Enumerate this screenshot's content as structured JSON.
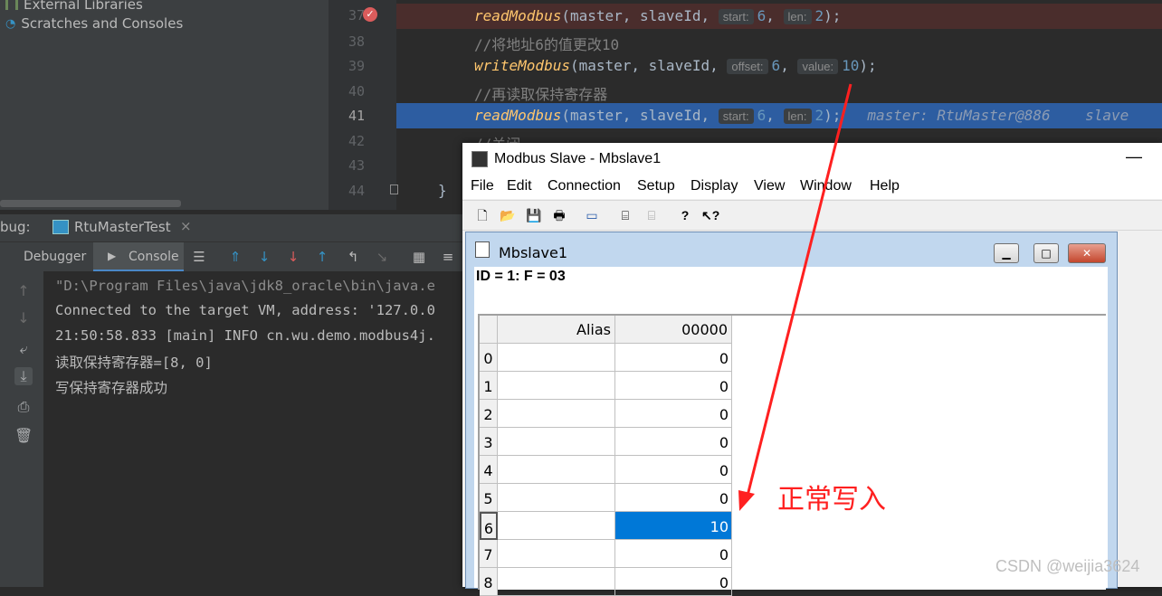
{
  "project": {
    "items": [
      "External Libraries",
      "Scratches and Consoles"
    ]
  },
  "editor": {
    "line_numbers": [
      "37",
      "38",
      "39",
      "40",
      "41",
      "42",
      "43",
      "44"
    ],
    "line37": {
      "fn": "readModbus",
      "args": "(master, slaveId, ",
      "hint1": "start:",
      "v1": "6",
      "hint2": "len:",
      "v2": "2",
      "end": ");"
    },
    "line38": "//将地址6的值更改10",
    "line39": {
      "fn": "writeModbus",
      "args": "(master, slaveId, ",
      "hint1": "offset:",
      "v1": "6",
      "hint2": "value:",
      "v2": "10",
      "end": ");"
    },
    "line40": "//再读取保持寄存器",
    "line41": {
      "fn": "readModbus",
      "args": "(master, slaveId, ",
      "hint1": "start:",
      "v1": "6",
      "hint2": "len:",
      "v2": "2",
      "end": ");",
      "inline1": "master: RtuMaster@886",
      "inline2": "slave"
    },
    "line42": "//关闭",
    "line44": "}"
  },
  "debug": {
    "label": "bug:",
    "config": "RtuMasterTest",
    "tabs": [
      "Debugger",
      "Console"
    ],
    "console_lines": [
      "\"D:\\Program Files\\java\\jdk8_oracle\\bin\\java.e",
      "Connected to the target VM, address: '127.0.0",
      "21:50:58.833 [main] INFO cn.wu.demo.modbus4j.",
      "读取保持寄存器=[8, 0]",
      "写保持寄存器成功"
    ]
  },
  "modbus": {
    "title": "Modbus Slave - Mbslave1",
    "menu": [
      "File",
      "Edit",
      "Connection",
      "Setup",
      "Display",
      "View",
      "Window",
      "Help"
    ],
    "child_title": "Mbslave1",
    "id_line": "ID = 1: F = 03",
    "col_alias": "Alias",
    "col_addr": "00000",
    "rows": [
      {
        "idx": "0",
        "value": "0"
      },
      {
        "idx": "1",
        "value": "0"
      },
      {
        "idx": "2",
        "value": "0"
      },
      {
        "idx": "3",
        "value": "0"
      },
      {
        "idx": "4",
        "value": "0"
      },
      {
        "idx": "5",
        "value": "0"
      },
      {
        "idx": "6",
        "value": "10"
      },
      {
        "idx": "7",
        "value": "0"
      },
      {
        "idx": "8",
        "value": "0"
      }
    ],
    "selected_row": "6"
  },
  "annotation": {
    "text": "正常写入",
    "color": "#ff2020"
  },
  "watermark": "CSDN @weijia3624"
}
